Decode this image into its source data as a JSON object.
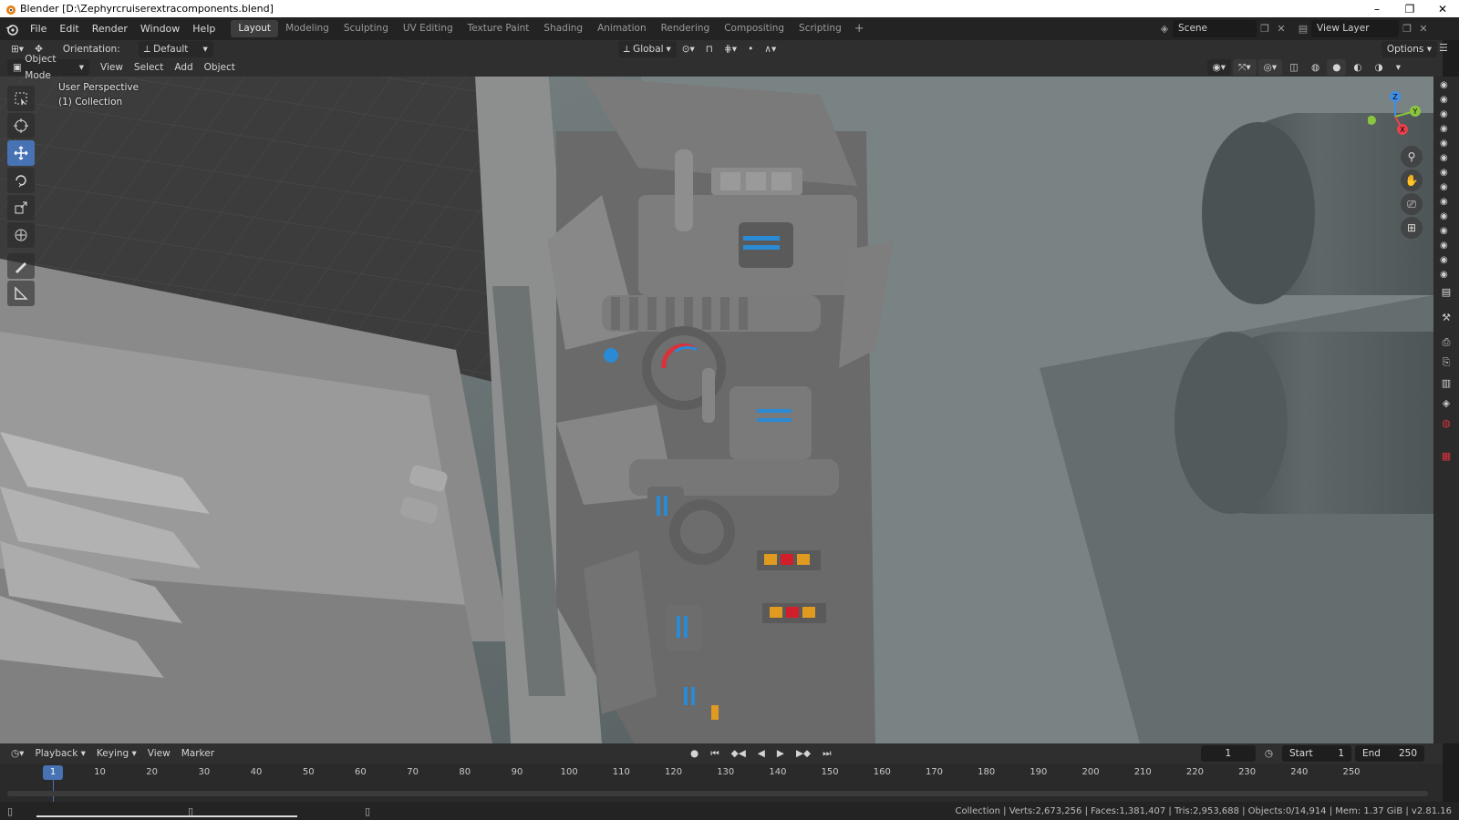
{
  "window": {
    "title": "Blender [D:\\Zephyrcruiserextracomponents.blend]",
    "controls": [
      "–",
      "❐",
      "✕"
    ]
  },
  "menu": [
    "File",
    "Edit",
    "Render",
    "Window",
    "Help"
  ],
  "workspaces": [
    "Layout",
    "Modeling",
    "Sculpting",
    "UV Editing",
    "Texture Paint",
    "Shading",
    "Animation",
    "Rendering",
    "Compositing",
    "Scripting"
  ],
  "active_workspace": "Layout",
  "scene": {
    "name": "Scene",
    "view_layer": "View Layer"
  },
  "header": {
    "orientation_label": "Orientation:",
    "orientation_value": "Default",
    "transform_orientation": "Global",
    "options_label": "Options"
  },
  "header2": {
    "mode": "Object Mode",
    "menus": [
      "View",
      "Select",
      "Add",
      "Object"
    ]
  },
  "viewport": {
    "perspective_label": "User Perspective",
    "collection_label": "(1) Collection",
    "gizmo_axes": {
      "x": "X",
      "y": "Y",
      "z": "Z"
    }
  },
  "timeline": {
    "menus": [
      "Playback",
      "Keying",
      "View",
      "Marker"
    ],
    "current_frame": "1",
    "start_label": "Start",
    "start_value": "1",
    "end_label": "End",
    "end_value": "250",
    "ticks": [
      "1",
      "10",
      "20",
      "30",
      "40",
      "50",
      "60",
      "70",
      "80",
      "90",
      "100",
      "110",
      "120",
      "130",
      "140",
      "150",
      "160",
      "170",
      "180",
      "190",
      "200",
      "210",
      "220",
      "230",
      "240",
      "250"
    ]
  },
  "status": {
    "stats": "Collection | Verts:2,673,256 | Faces:1,381,407 | Tris:2,953,688 | Objects:0/14,914 | Mem: 1.37 GiB | v2.81.16"
  },
  "colors": {
    "accent": "#4772b3",
    "x_axis": "#e8414e",
    "y_axis": "#8bc53f",
    "z_axis": "#3f8fe8"
  }
}
